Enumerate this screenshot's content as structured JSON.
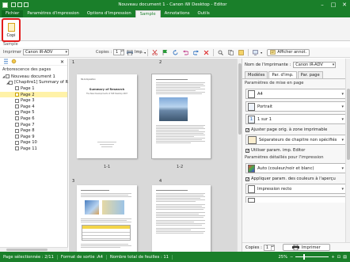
{
  "window": {
    "title": "Nouveau document 1 - Canon iW Desktop - Editor"
  },
  "tabs": [
    {
      "label": "Fichier",
      "name": "tab-fichier"
    },
    {
      "label": "Paramètres d'impression",
      "name": "tab-parametres-impression"
    },
    {
      "label": "Options d'impression",
      "name": "tab-options-impression"
    },
    {
      "label": "Sample",
      "name": "tab-sample"
    },
    {
      "label": "Annotations",
      "name": "tab-annotations"
    },
    {
      "label": "Outils",
      "name": "tab-outils"
    }
  ],
  "ribbon": {
    "copy_label": "Copi",
    "group_label": "Sample"
  },
  "toolbar": {
    "printer_label": "Imprimer",
    "printer_value": "Canon iR-ADV",
    "copies_label": "Copies :",
    "copies_value": "1",
    "imp_label": "Imp.",
    "annot_label": "Afficher annot."
  },
  "leftpane": {
    "header": "Arborescence des pages",
    "tree": [
      {
        "label": "Nouveau document 1",
        "level": 0,
        "toggle": "◢",
        "selected": false
      },
      {
        "label": "[Chapitre1] Summary of R",
        "level": 1,
        "toggle": "◢",
        "selected": false
      },
      {
        "label": "Page 1",
        "level": 2,
        "toggle": "",
        "selected": false
      },
      {
        "label": "Page 2",
        "level": 2,
        "toggle": "",
        "selected": true
      },
      {
        "label": "Page 3",
        "level": 2,
        "toggle": "",
        "selected": false
      },
      {
        "label": "Page 4",
        "level": 2,
        "toggle": "",
        "selected": false
      },
      {
        "label": "Page 5",
        "level": 2,
        "toggle": "",
        "selected": false
      },
      {
        "label": "Page 6",
        "level": 2,
        "toggle": "",
        "selected": false
      },
      {
        "label": "Page 7",
        "level": 2,
        "toggle": "",
        "selected": false
      },
      {
        "label": "Page 8",
        "level": 2,
        "toggle": "",
        "selected": false
      },
      {
        "label": "Page 9",
        "level": 2,
        "toggle": "",
        "selected": false
      },
      {
        "label": "Page 10",
        "level": 2,
        "toggle": "",
        "selected": false
      },
      {
        "label": "Page 11",
        "level": 2,
        "toggle": "",
        "selected": false
      }
    ]
  },
  "main": {
    "pages": [
      {
        "number": "1",
        "label": "1-1",
        "heading": "Summary of Research",
        "sub": "The New Developments of iWE Desktop 2007",
        "title_small": "iW-Composition"
      },
      {
        "number": "2",
        "label": "1-2"
      },
      {
        "number": "3",
        "label": ""
      },
      {
        "number": "4",
        "label": ""
      }
    ]
  },
  "rightpane": {
    "printer_name_label": "Nom de l'imprimante :",
    "printer_name_value": "Canon iR-ADV",
    "tabs": [
      "Modèles",
      "Par. d'imp.",
      "Par. page"
    ],
    "section_page": "Paramètres de mise en page",
    "paper_value": "A4",
    "orientation_value": "Portrait",
    "layout_value": "1 sur 1",
    "check_adjust": "Ajuster page orig. à zone imprimable",
    "separator_value": "Séparateurs de chapitre non spécifiés",
    "check_editor": "Utiliser param. imp. Editor",
    "section_detail": "Paramètres détaillés pour l'impression",
    "color_value": "Auto (couleur/noir et blanc)",
    "check_color": "Appliquer param. des couleurs à l'aperçu",
    "duplex_value": "Impression recto",
    "copies_label": "Copies :",
    "copies_value": "1",
    "print_button": "Imprimer"
  },
  "status": {
    "selected_page": "Page sélectionnée : 2/11",
    "output_format": "Format de sortie :A4",
    "total_sheets": "Nombre total de feuilles : 11",
    "zoom": "25%",
    "zoom_level": 0.25
  },
  "colors": {
    "accent": "#1a7f2a",
    "highlight": "#e21b1b",
    "selected_row": "#fff2a8"
  }
}
